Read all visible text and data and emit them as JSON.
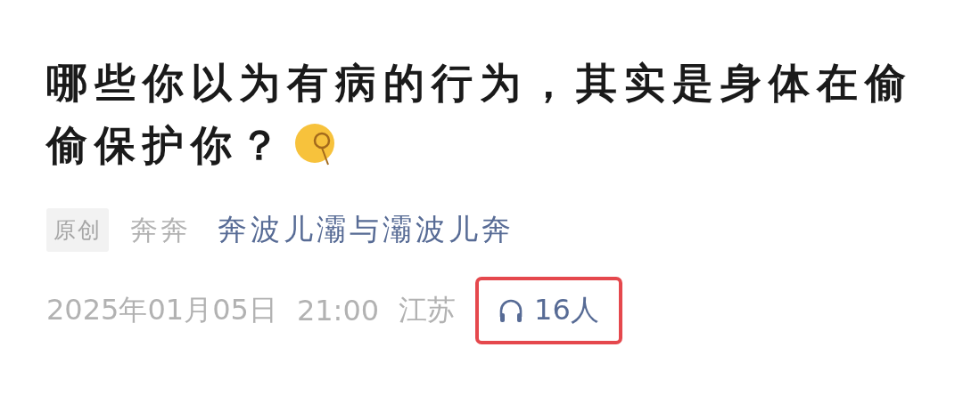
{
  "title": "哪些你以为有病的行为，其实是身体在偷偷保护你？",
  "meta": {
    "tag": "原创",
    "author": "奔奔",
    "account": "奔波儿灞与灞波儿奔"
  },
  "info": {
    "date": "2025年01月05日",
    "time": "21:00",
    "location": "江苏",
    "listeners": "16人"
  }
}
